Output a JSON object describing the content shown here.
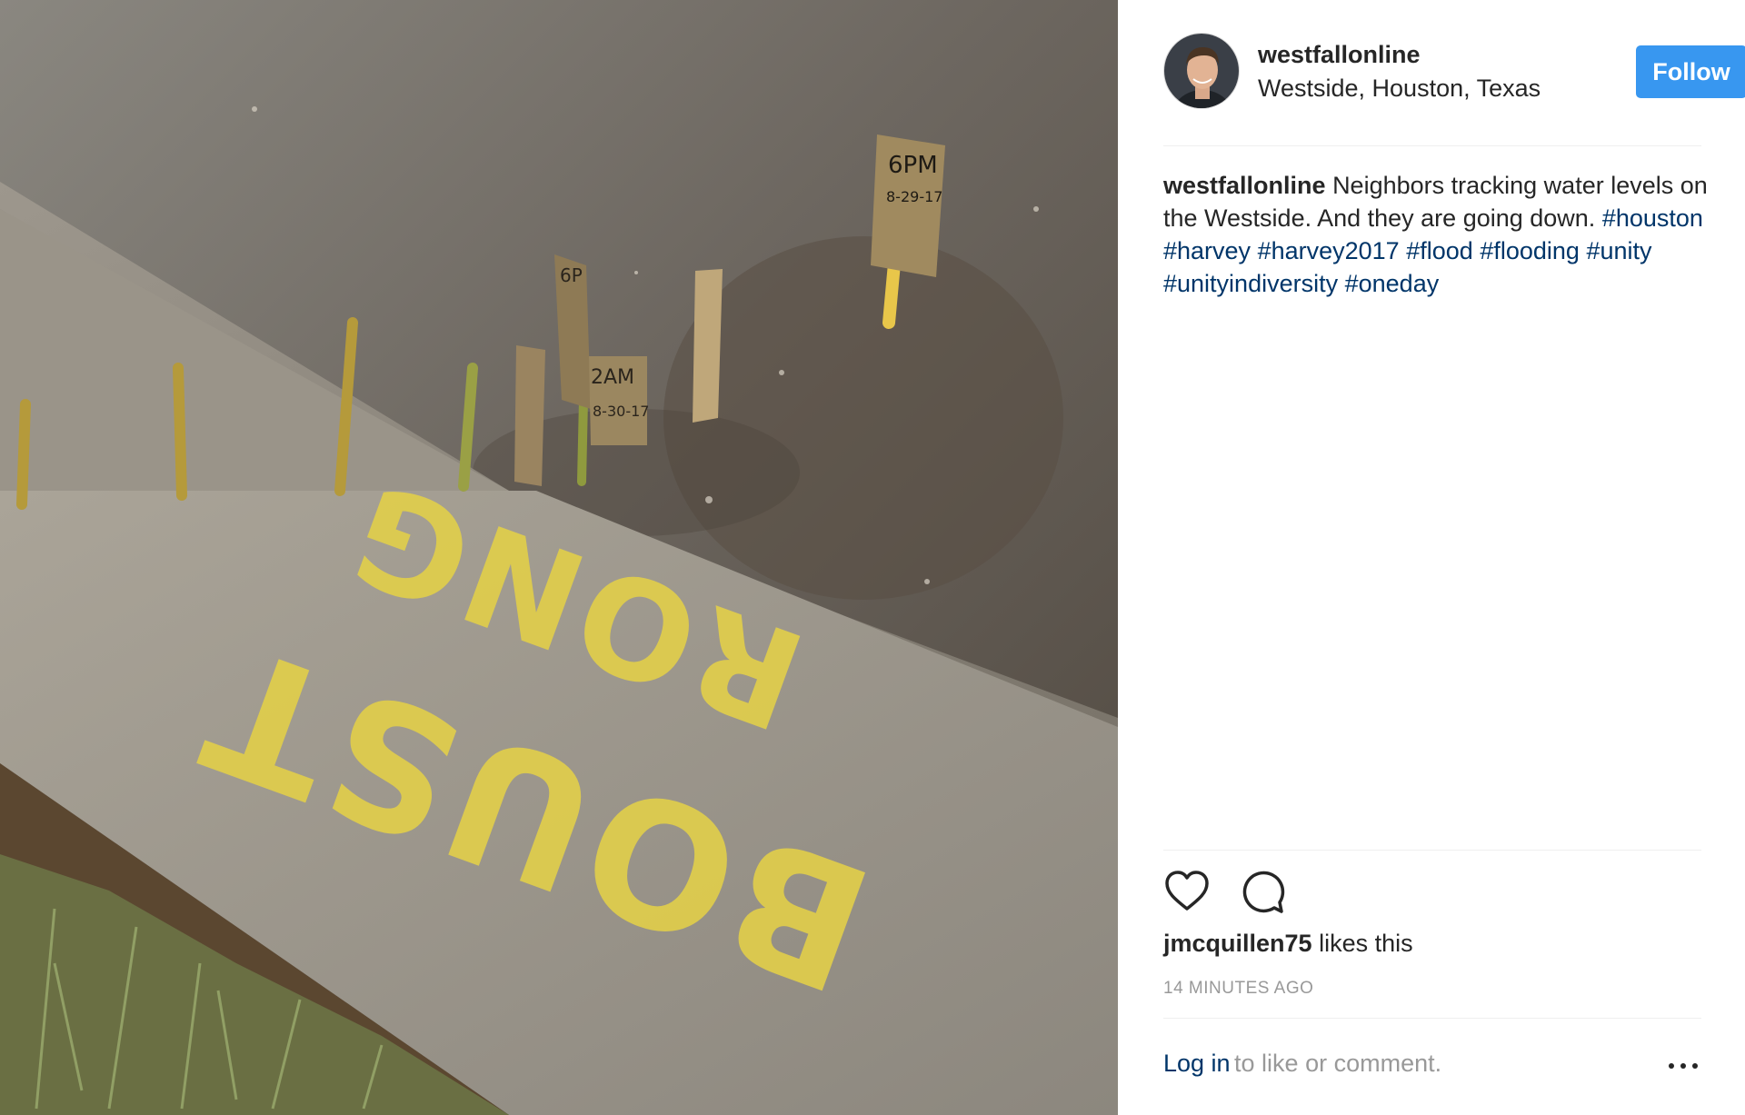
{
  "post": {
    "username": "westfallonline",
    "location": "Westside, Houston, Texas",
    "follow_label": "Follow",
    "caption": {
      "username": "westfallonline",
      "text": "Neighbors tracking water levels on the Westside. And they are going down.",
      "hashtags": [
        "#houston",
        "#harvey",
        "#harvey2017",
        "#flood",
        "#flooding",
        "#unity",
        "#unityindiversity",
        "#oneday"
      ]
    },
    "likes": {
      "liker": "jmcquillen75",
      "suffix": "likes this"
    },
    "timestamp": "14 MINUTES AGO",
    "login": {
      "link_label": "Log in",
      "rest": "to like or comment."
    }
  },
  "photo": {
    "signs": [
      "6PM 8-29-17",
      "2AM 8-30-17",
      "6PM"
    ],
    "painted_text": "BOUST RONG"
  },
  "icons": {
    "like": "heart-outline-icon",
    "comment": "comment-bubble-icon",
    "more": "more-options-icon"
  },
  "colors": {
    "follow_button": "#3897f0",
    "link": "#003569",
    "muted": "#999999",
    "text": "#262626"
  }
}
